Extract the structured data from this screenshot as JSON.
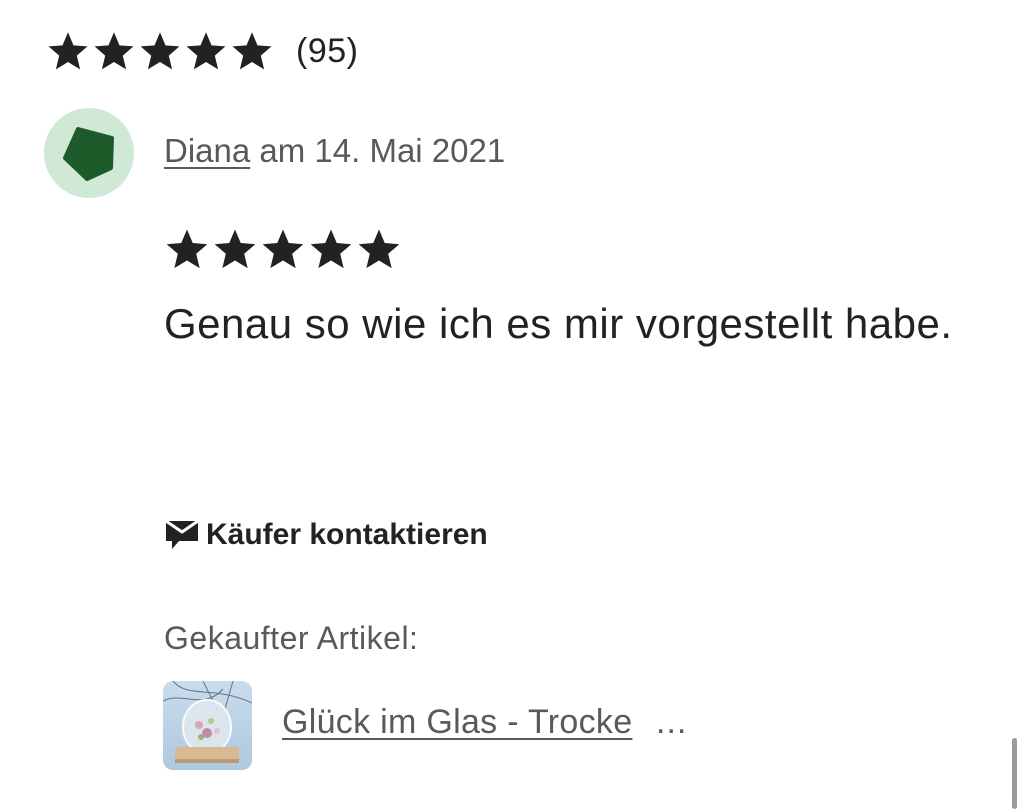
{
  "summary": {
    "rating": 5,
    "max_rating": 5,
    "review_count": "(95)"
  },
  "review": {
    "reviewer_name": "Diana",
    "date_text": " am 14. Mai 2021",
    "rating": 5,
    "text": "Genau so wie ich es mir vorgestellt habe.",
    "avatar_color": "#1e5b2b",
    "avatar_bg": "#cfe9d6"
  },
  "actions": {
    "contact_buyer_label": "Käufer kontaktieren"
  },
  "purchased": {
    "label": "Gekaufter Artikel:",
    "item_title": "Glück im Glas - Trocke",
    "item_ellipsis": "..."
  },
  "icons": {
    "star": "star-icon",
    "contact": "message-icon"
  }
}
